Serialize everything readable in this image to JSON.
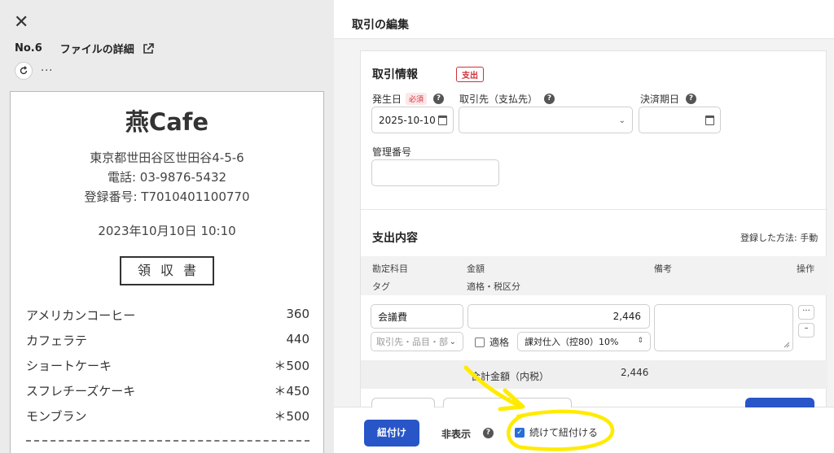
{
  "left_panel": {
    "file_number": "No.6",
    "file_details_label": "ファイルの詳細",
    "more_label": "···"
  },
  "receipt": {
    "shop_name": "燕Cafe",
    "address": "東京都世田谷区世田谷4-5-6",
    "phone": "電話: 03-9876-5432",
    "registration": "登録番号:  T7010401100770",
    "datetime": "2023年10月10日    10:10",
    "title": "領収書",
    "items": [
      {
        "name": "アメリカンコーヒー",
        "price": "360"
      },
      {
        "name": "カフェラテ",
        "price": "440"
      },
      {
        "name": "ショートケーキ",
        "price": "＊500"
      },
      {
        "name": "スフレチーズケーキ",
        "price": "＊450"
      },
      {
        "name": "モンブラン",
        "price": "＊500"
      }
    ]
  },
  "right_panel": {
    "header_title": "取引の編集",
    "transaction_info": {
      "title": "取引情報",
      "type_badge": "支出",
      "issue_date_label": "発生日",
      "required_badge": "必須",
      "issue_date_value": "2025-10-10",
      "partner_label": "取引先（支払先）",
      "partner_value": "",
      "due_date_label": "決済期日",
      "due_date_value": "",
      "management_no_label": "管理番号",
      "management_no_value": ""
    },
    "expense": {
      "title": "支出内容",
      "registered_method": "登録した方法: 手動",
      "headers": {
        "account": "勘定科目",
        "amount": "金額",
        "memo": "備考",
        "action": "操作",
        "tag": "タグ",
        "tax": "適格・税区分"
      },
      "row": {
        "account": "会議費",
        "amount": "2,446",
        "tags_placeholder": "取引先・品目・部門",
        "qualified_label": "適格",
        "qualified_checked": false,
        "tax_category": "課対仕入（控80）10%",
        "memo": ""
      },
      "total_label": "合計金額（内税）",
      "total_value": "2,446"
    },
    "footer": {
      "link_button": "紐付け",
      "hide_button": "非表示",
      "continue_label": "続けて紐付ける",
      "continue_checked": true
    }
  },
  "colors": {
    "primary": "#2855c8",
    "danger": "#d0303a",
    "annotation": "#ffeb00"
  }
}
